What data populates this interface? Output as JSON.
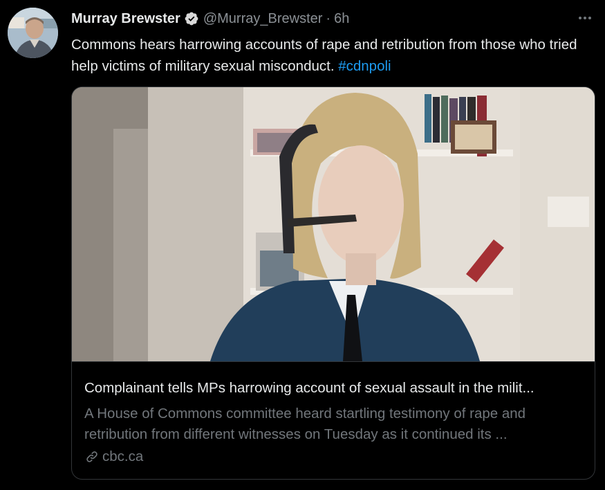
{
  "author": {
    "name": "Murray Brewster",
    "handle": "@Murray_Brewster",
    "separator": "·",
    "time": "6h"
  },
  "tweet": {
    "text": "Commons hears harrowing accounts of rape and retribution from those who tried help victims of military sexual misconduct.",
    "hashtag": "#cdnpoli"
  },
  "card": {
    "title": "Complainant tells MPs harrowing account of sexual assault in the milit...",
    "description": "A House of Commons committee heard startling testimony of rape and retribution from different witnesses on Tuesday as it continued its ...",
    "domain": "cbc.ca"
  },
  "icons": {
    "verified": "verified-badge-icon",
    "more": "more-options-icon",
    "link": "link-icon"
  },
  "colors": {
    "background": "#000000",
    "text": "#e7e9ea",
    "secondary": "#71767b",
    "accent": "#1d9bf0"
  }
}
